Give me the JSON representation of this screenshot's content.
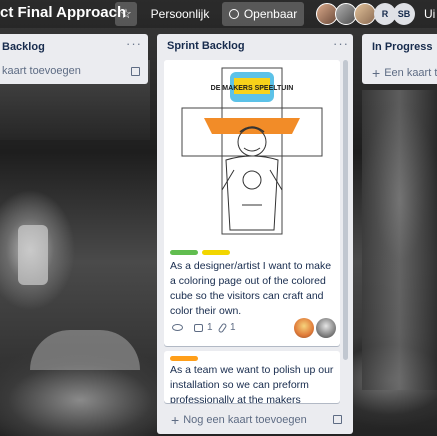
{
  "header": {
    "board_title": "ct Final Approach",
    "star_icon": "star-icon",
    "personal_label": "Persoonlijk",
    "visibility_label": "Openbaar",
    "visibility_icon": "globe-icon",
    "members": [
      {
        "initials": "R",
        "color": "#dfe1e6"
      },
      {
        "initials": "SB",
        "color": "#dfe1e6"
      }
    ],
    "overflow_text": "Ui"
  },
  "lists": {
    "backlog": {
      "title": "Backlog",
      "add_card": "kaart toevoegen"
    },
    "sprint_backlog": {
      "title": "Sprint Backlog",
      "menu": "···",
      "cards": [
        {
          "cover_image": "coloring-page-cube-illustration",
          "cover_caption": "DE MAKERS SPEELTUIN",
          "labels": [
            "#61bd4f",
            "#f2d600"
          ],
          "text": "As a designer/artist I want to make a coloring page out of the colored cube so the visitors can craft and color their own.",
          "comments": "1",
          "attachments": "1"
        },
        {
          "labels": [
            "#ff9f1a"
          ],
          "text": "As a team we want to polish up our installation so we can preform professionally at the makers festival"
        }
      ],
      "add_card": "Nog een kaart toevoegen"
    },
    "in_progress": {
      "title": "In Progress",
      "add_card": "Een kaart to"
    }
  }
}
